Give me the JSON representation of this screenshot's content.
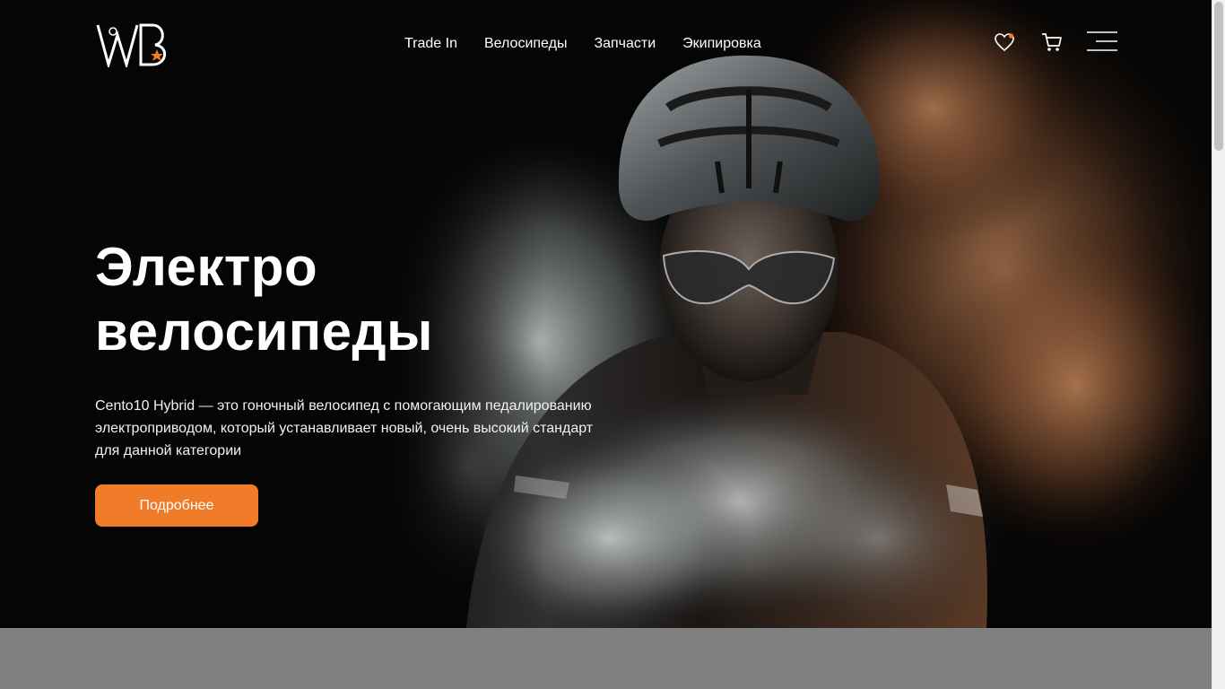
{
  "brand": {
    "logo_alt": "WB",
    "accent_color": "#f07c2a"
  },
  "nav": {
    "items": [
      {
        "label": "Trade In"
      },
      {
        "label": "Велосипеды"
      },
      {
        "label": "Запчасти"
      },
      {
        "label": "Экипировка"
      }
    ]
  },
  "header_icons": {
    "favorites": "heart-icon",
    "cart": "cart-icon",
    "menu": "hamburger-menu-icon"
  },
  "hero": {
    "title_line1": "Электро",
    "title_line2": "велосипеды",
    "description": "Cento10 Hybrid — это гоночный велосипед с помогающим педалированию электроприводом, который устанавливает новый, очень высокий стандарт для данной категории",
    "button_label": "Подробнее",
    "image": "cyclist-in-helmet-with-smoke"
  }
}
